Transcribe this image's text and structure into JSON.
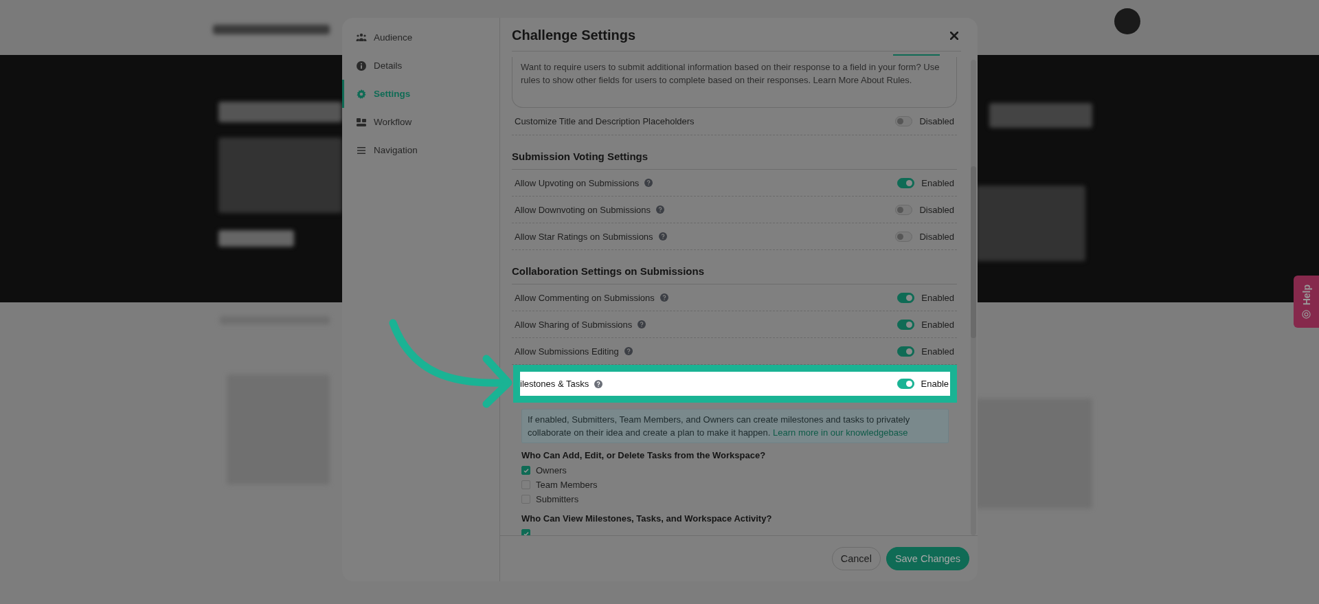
{
  "modal": {
    "title": "Challenge Settings",
    "nav": [
      {
        "label": "Audience",
        "selected": false
      },
      {
        "label": "Details",
        "selected": false
      },
      {
        "label": "Settings",
        "selected": true
      },
      {
        "label": "Workflow",
        "selected": false
      },
      {
        "label": "Navigation",
        "selected": false
      }
    ],
    "rules_note": "Want to require users to submit additional information based on their response to a field in your form? Use rules to show other fields for users to complete based on their responses. Learn More About Rules.",
    "sections": [
      {
        "rows": [
          {
            "label": "Customize Title and Description Placeholders",
            "help": false,
            "on": false,
            "status": "Disabled",
            "highlighted": false
          }
        ]
      },
      {
        "heading": "Submission Voting Settings",
        "rows": [
          {
            "label": "Allow Upvoting on Submissions",
            "help": true,
            "on": true,
            "status": "Enabled",
            "highlighted": false
          },
          {
            "label": "Allow Downvoting on Submissions",
            "help": true,
            "on": false,
            "status": "Disabled",
            "highlighted": false
          },
          {
            "label": "Allow Star Ratings on Submissions",
            "help": true,
            "on": false,
            "status": "Disabled",
            "highlighted": false
          }
        ]
      },
      {
        "heading": "Collaboration Settings on Submissions",
        "rows": [
          {
            "label": "Allow Commenting on Submissions",
            "help": true,
            "on": true,
            "status": "Enabled",
            "highlighted": false
          },
          {
            "label": "Allow Sharing of Submissions",
            "help": true,
            "on": true,
            "status": "Enabled",
            "highlighted": false
          },
          {
            "label": "Allow Submissions Editing",
            "help": true,
            "on": true,
            "status": "Enabled",
            "highlighted": false
          },
          {
            "label": "ilestones & Tasks",
            "help": true,
            "on": true,
            "status": "Enable",
            "highlighted": true
          }
        ]
      }
    ],
    "info": {
      "text": "If enabled, Submitters, Team Members, and Owners can create milestones and tasks to privately collaborate on their idea and create a plan to make it happen.",
      "link": "Learn more in our knowledgebase"
    },
    "permission_groups": [
      {
        "heading": "Who Can Add, Edit, or Delete Tasks from the Workspace?",
        "options": [
          {
            "label": "Owners",
            "checked": true
          },
          {
            "label": "Team Members",
            "checked": false
          },
          {
            "label": "Submitters",
            "checked": false
          }
        ]
      },
      {
        "heading": "Who Can View Milestones, Tasks, and Workspace Activity?",
        "options": [
          {
            "checked": true
          }
        ]
      }
    ],
    "buttons": [
      {
        "label": "Cancel",
        "kind": "secondary"
      },
      {
        "label": "Save Changes",
        "kind": "primary"
      }
    ]
  },
  "help_tab": {
    "label": "Help"
  }
}
